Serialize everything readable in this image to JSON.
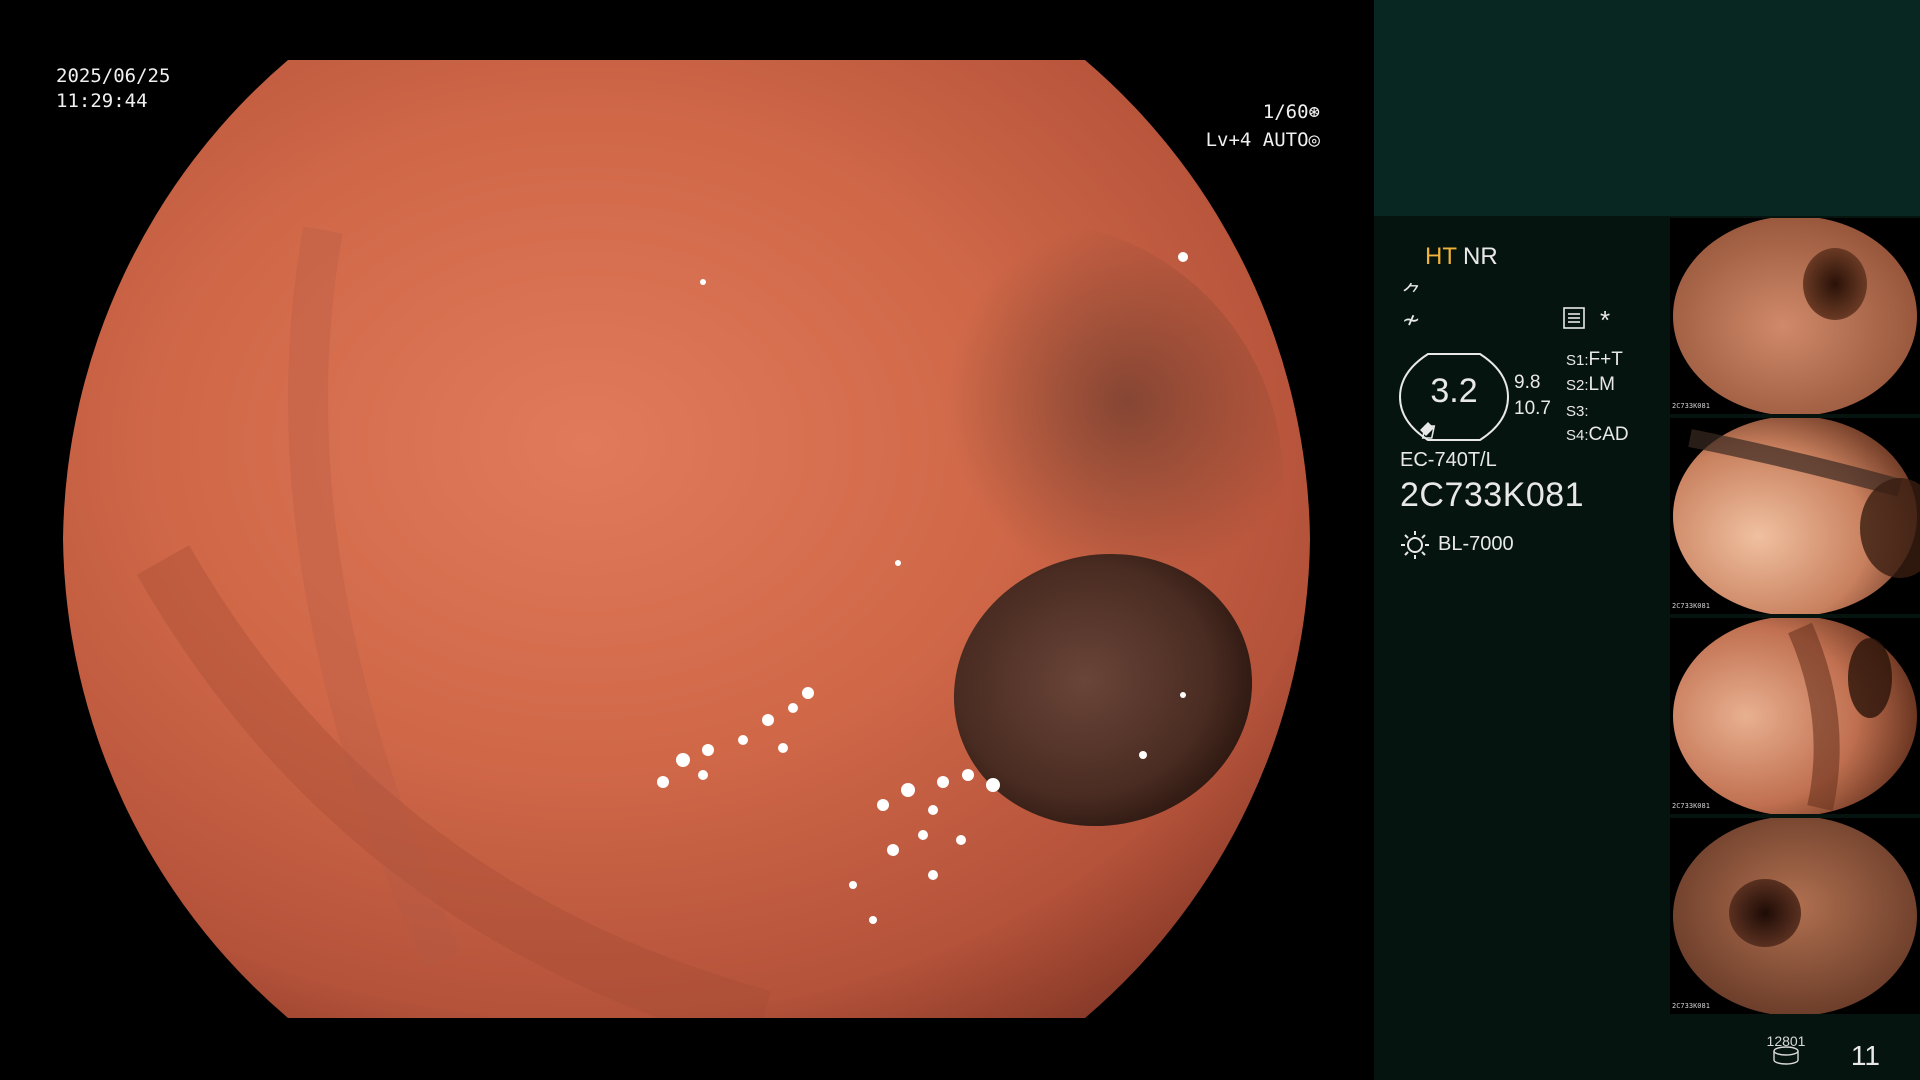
{
  "overlay": {
    "date": "2025/06/25",
    "time": "11:29:44",
    "shutter": "1/60",
    "level": "Lv+4 AUTO"
  },
  "panel": {
    "ht": "HT",
    "nr": "NR",
    "sym_enhance": "⺈",
    "sym_filter": "≁",
    "star": "*",
    "zoom": "3.2",
    "zoom_a": "9.8",
    "zoom_b": "10.7",
    "settings": [
      {
        "key": "S1:",
        "value": "F+T"
      },
      {
        "key": "S2:",
        "value": "LM"
      },
      {
        "key": "S3:",
        "value": ""
      },
      {
        "key": "S4:",
        "value": "CAD"
      }
    ],
    "scope_model": "EC-740T/L",
    "scope_serial": "2C733K081",
    "light_source": "BL-7000"
  },
  "thumbnails": [
    {
      "caption": "2C733K081"
    },
    {
      "caption": "2C733K081"
    },
    {
      "caption": "2C733K081"
    },
    {
      "caption": "2C733K081"
    }
  ],
  "footer": {
    "record_count": "12801",
    "image_count": "11"
  },
  "colors": {
    "ht_accent": "#f0b23a",
    "panel_top": "#082722",
    "panel_body": "#061410"
  }
}
